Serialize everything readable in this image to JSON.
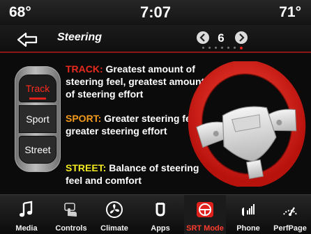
{
  "status": {
    "temp_left": "68°",
    "time": "7:07",
    "temp_right": "71°"
  },
  "header": {
    "title": "Steering",
    "page_number": "6",
    "page_count": 7,
    "active_page_index": 6
  },
  "modes": [
    {
      "label": "Track",
      "selected": true
    },
    {
      "label": "Sport",
      "selected": false
    },
    {
      "label": "Street",
      "selected": false
    }
  ],
  "descriptions": {
    "track": {
      "key": "TRACK:",
      "text": " Greatest amount of steering feel, greatest amount of steering effort"
    },
    "sport": {
      "key": "SPORT:",
      "text": " Greater steering feel, greater steering effort"
    },
    "street": {
      "key": "STREET:",
      "text": " Balance of steering feel and comfort"
    }
  },
  "nav": [
    {
      "label": "Media",
      "icon": "music-note-icon"
    },
    {
      "label": "Controls",
      "icon": "controls-hand-icon"
    },
    {
      "label": "Climate",
      "icon": "climate-fan-icon"
    },
    {
      "label": "Apps",
      "icon": "apps-icon"
    },
    {
      "label": "SRT Mode",
      "icon": "srt-steering-icon",
      "active": true
    },
    {
      "label": "Phone",
      "icon": "phone-signal-icon"
    },
    {
      "label": "PerfPage",
      "icon": "performance-gauge-icon"
    }
  ],
  "colors": {
    "accent_red": "#e0201b",
    "track": "#ea2a1e",
    "sport": "#f39a1c",
    "street": "#f3ea21"
  }
}
